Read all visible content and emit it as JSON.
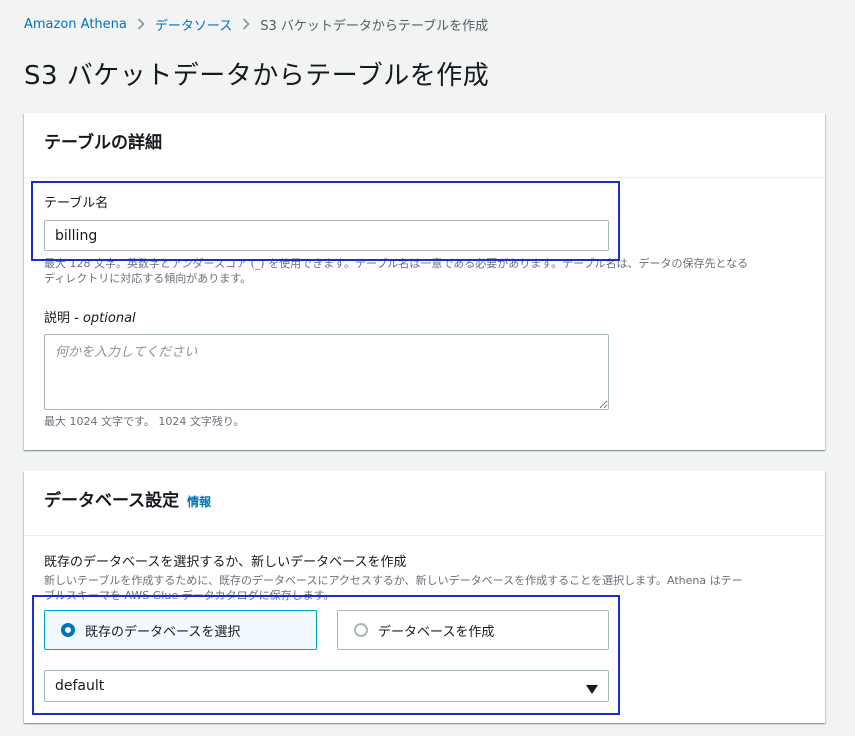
{
  "breadcrumb": {
    "items": [
      "Amazon Athena",
      "データソース",
      "S3 バケットデータからテーブルを作成"
    ]
  },
  "page": {
    "title": "S3 バケットデータからテーブルを作成"
  },
  "table_details": {
    "heading": "テーブルの詳細",
    "table_name_label": "テーブル名",
    "table_name_value": "billing",
    "table_name_constraint_1": "最大 128 文字。英数字とアンダースコア (_) を使用できます。テーブル名は一意である必要があります。テーブル名は、データの保存先となる",
    "table_name_constraint_2": "ディレクトリに対応する傾向があります。",
    "description_label": "説明",
    "description_optional": " - optional",
    "description_placeholder": "何かを入力してください",
    "description_constraint": "最大 1024 文字です。 1024 文字残り。"
  },
  "database_settings": {
    "heading": "データベース設定",
    "info_link": "情報",
    "choice_label": "既存のデータベースを選択するか、新しいデータベースを作成",
    "choice_description_1": "新しいテーブルを作成するために、既存のデータベースにアクセスするか、新しいデータベースを作成することを選択します。Athena はテー",
    "choice_description_2": "ブルスキーマを AWS Glue データカタログに保存します。",
    "option_existing": "既存のデータベースを選択",
    "option_create": "データベースを作成",
    "selected_database": "default"
  },
  "colors": {
    "link": "#0073bb",
    "highlight": "#1a2ecc",
    "selected_tile_bg": "#f1faff"
  }
}
